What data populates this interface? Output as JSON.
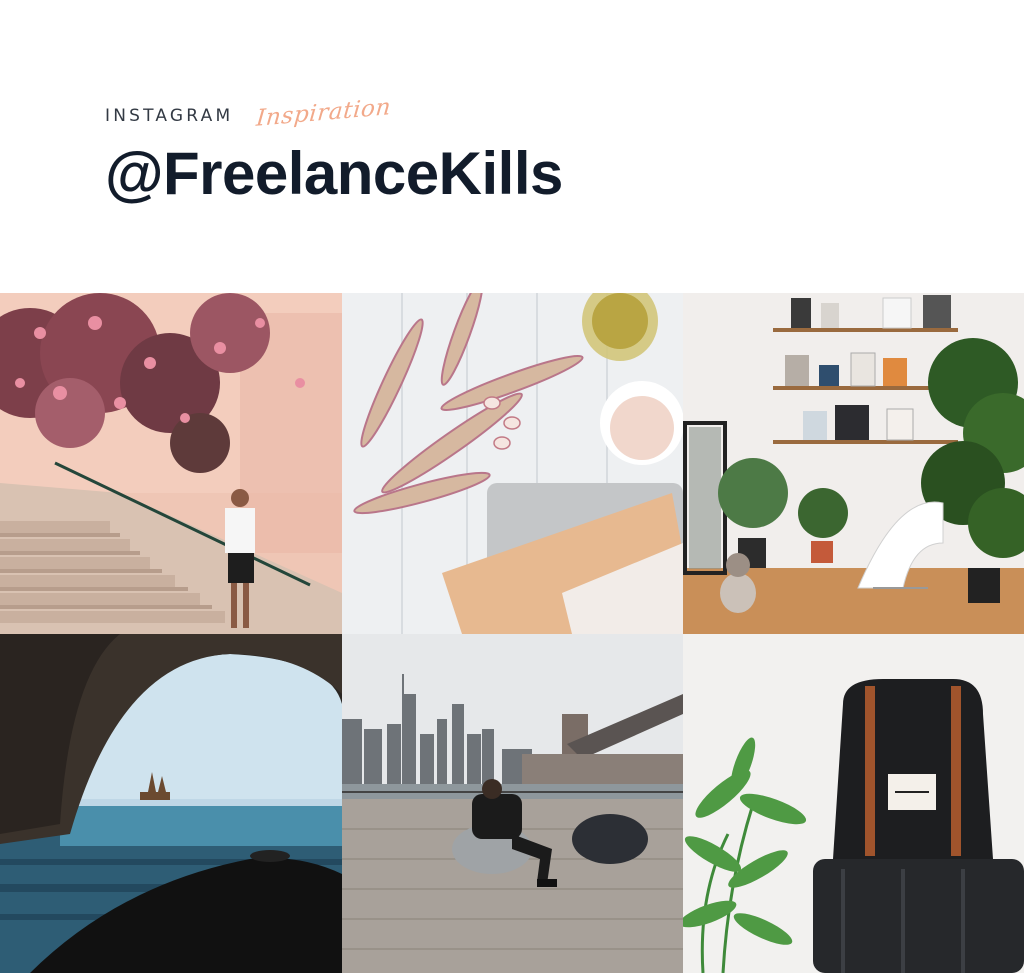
{
  "header": {
    "kicker": "INSTAGRAM",
    "script_word": "Inspiration",
    "handle": "@FreelanceKills"
  },
  "grid": {
    "tiles": [
      {
        "name": "photo-pink-wall-stairs"
      },
      {
        "name": "photo-beans-flatlay"
      },
      {
        "name": "photo-shelves-plants-cat"
      },
      {
        "name": "photo-sea-cave-boat"
      },
      {
        "name": "photo-city-skyline-beanbag"
      },
      {
        "name": "photo-backpack-luggage"
      }
    ]
  },
  "colors": {
    "accent": "#f2a98a",
    "heading": "#121c2b",
    "kicker": "#333a44"
  }
}
